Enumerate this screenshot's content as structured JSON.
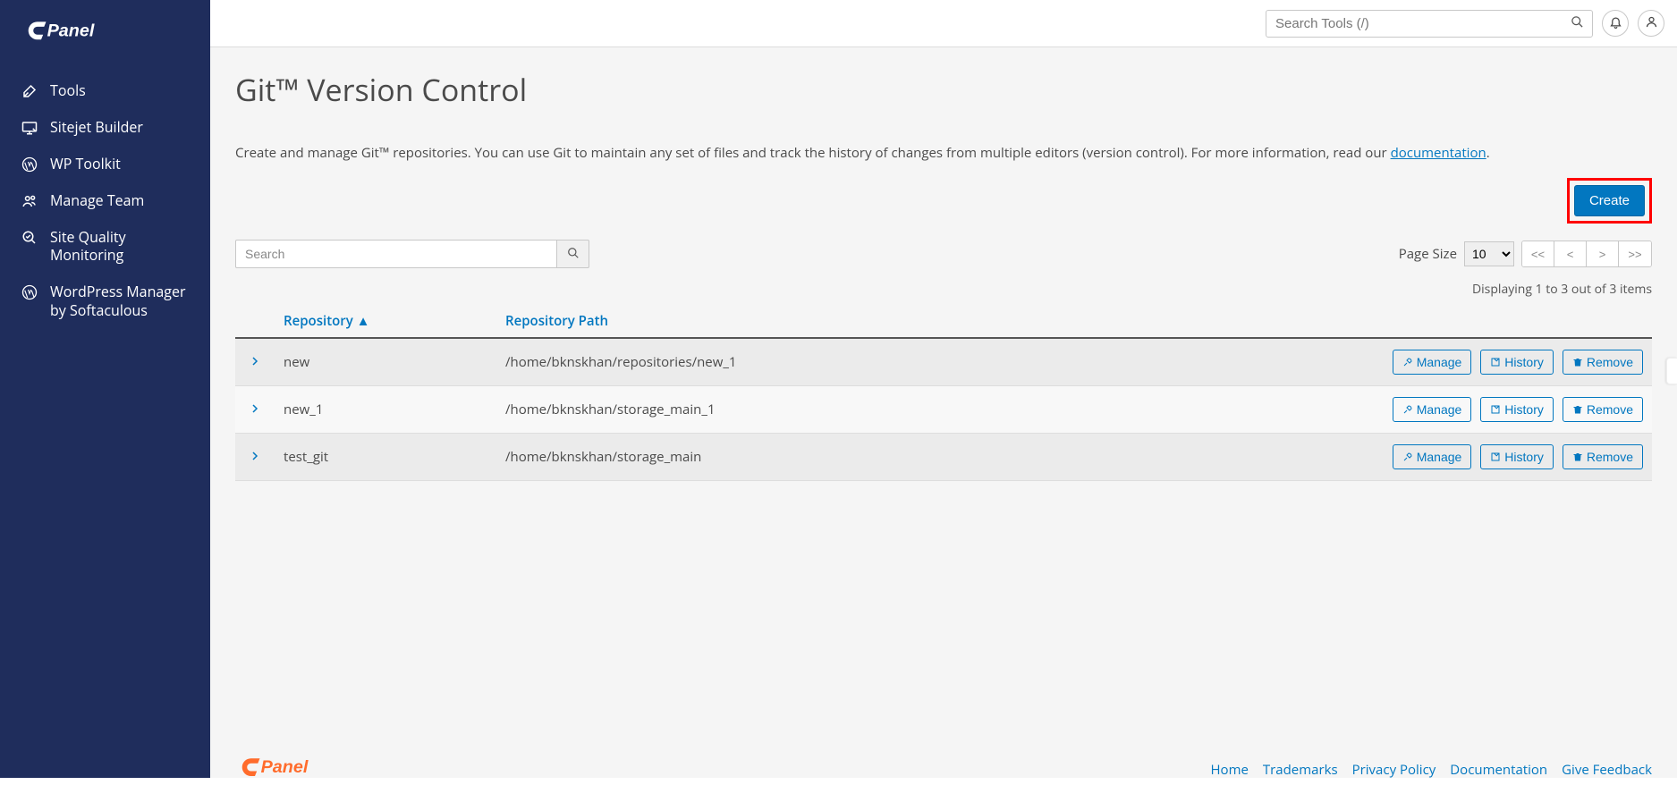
{
  "topbar": {
    "search_placeholder": "Search Tools (/)"
  },
  "sidebar": {
    "items": [
      {
        "label": "Tools"
      },
      {
        "label": "Sitejet Builder"
      },
      {
        "label": "WP Toolkit"
      },
      {
        "label": "Manage Team"
      },
      {
        "label": "Site Quality Monitoring"
      },
      {
        "label": "WordPress Manager by Softaculous"
      }
    ]
  },
  "page": {
    "title": "Git™ Version Control",
    "desc_prefix": "Create and manage Git™ repositories. You can use Git to maintain any set of files and track the history of changes from multiple editors (version control). For more information, read our ",
    "desc_link": "documentation",
    "desc_suffix": ".",
    "create_label": "Create",
    "search_placeholder": "Search",
    "page_size_label": "Page Size",
    "page_size_value": "10",
    "pager": {
      "first": "<<",
      "prev": "<",
      "next": ">",
      "last": ">>"
    },
    "displaying": "Displaying 1 to 3 out of 3 items",
    "columns": {
      "repo": "Repository ▲",
      "path": "Repository Path"
    },
    "actions": {
      "manage": "Manage",
      "history": "History",
      "remove": "Remove"
    },
    "rows": [
      {
        "name": "new",
        "path": "/home/bknskhan/repositories/new_1"
      },
      {
        "name": "new_1",
        "path": "/home/bknskhan/storage_main_1"
      },
      {
        "name": "test_git",
        "path": "/home/bknskhan/storage_main"
      }
    ]
  },
  "footer": {
    "links": [
      {
        "label": "Home"
      },
      {
        "label": "Trademarks"
      },
      {
        "label": "Privacy Policy"
      },
      {
        "label": "Documentation"
      },
      {
        "label": "Give Feedback"
      }
    ]
  }
}
